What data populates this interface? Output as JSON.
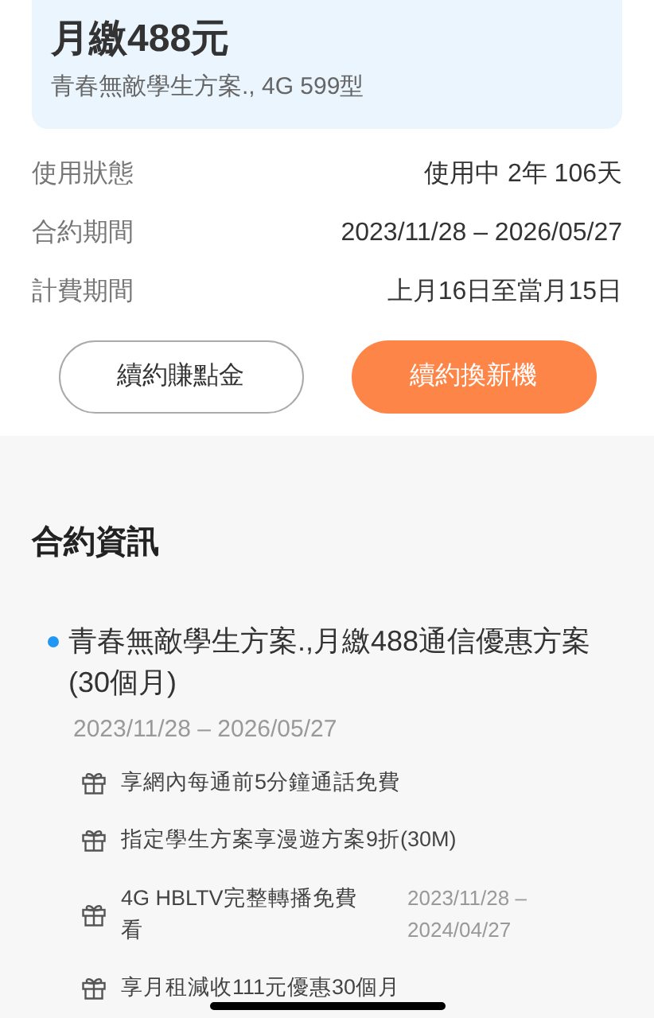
{
  "plan_card": {
    "price": "月繳488元",
    "name": "青春無敵學生方案., 4G 599型"
  },
  "details": [
    {
      "label": "使用狀態",
      "value": "使用中 2年 106天"
    },
    {
      "label": "合約期間",
      "value": "2023/11/28 – 2026/05/27"
    },
    {
      "label": "計費期間",
      "value": "上月16日至當月15日"
    }
  ],
  "buttons": [
    {
      "label": "續約賺點金",
      "kind": "outline"
    },
    {
      "label": "續約換新機",
      "kind": "primary"
    }
  ],
  "contract": {
    "title": "合約資訊",
    "items": [
      {
        "name": "青春無敵學生方案.,月繳488通信優惠方案(30個月)",
        "period": "2023/11/28 – 2026/05/27",
        "perks": [
          {
            "text": "享網內每通前5分鐘通話免費"
          },
          {
            "text": "指定學生方案享漫遊方案9折(30M)"
          },
          {
            "text": "4G HBLTV完整轉播免費看",
            "period": "2023/11/28 – 2024/04/27"
          },
          {
            "text": "享月租減收111元優惠30個月"
          }
        ]
      }
    ]
  }
}
